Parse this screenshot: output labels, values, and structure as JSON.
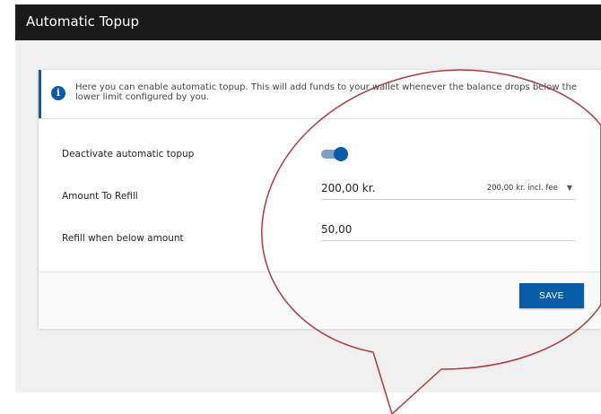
{
  "header": {
    "title": "Automatic Topup"
  },
  "info": {
    "icon": "info-icon",
    "text": "Here you can enable automatic topup. This will add funds to your wallet whenever the balance drops below the lower limit configured by you."
  },
  "settings": {
    "toggle_label": "Deactivate automatic topup",
    "toggle_on": true,
    "amount_label": "Amount To Refill",
    "amount_value": "200,00 kr.",
    "amount_fee": "200,00 kr. incl. fee",
    "threshold_label": "Refill when below amount",
    "threshold_value": "50,00"
  },
  "footer": {
    "save_label": "SAVE"
  },
  "colors": {
    "accent": "#0a5ba8",
    "titlebar": "#1a1a1a",
    "annotation": "#b03a3a"
  }
}
